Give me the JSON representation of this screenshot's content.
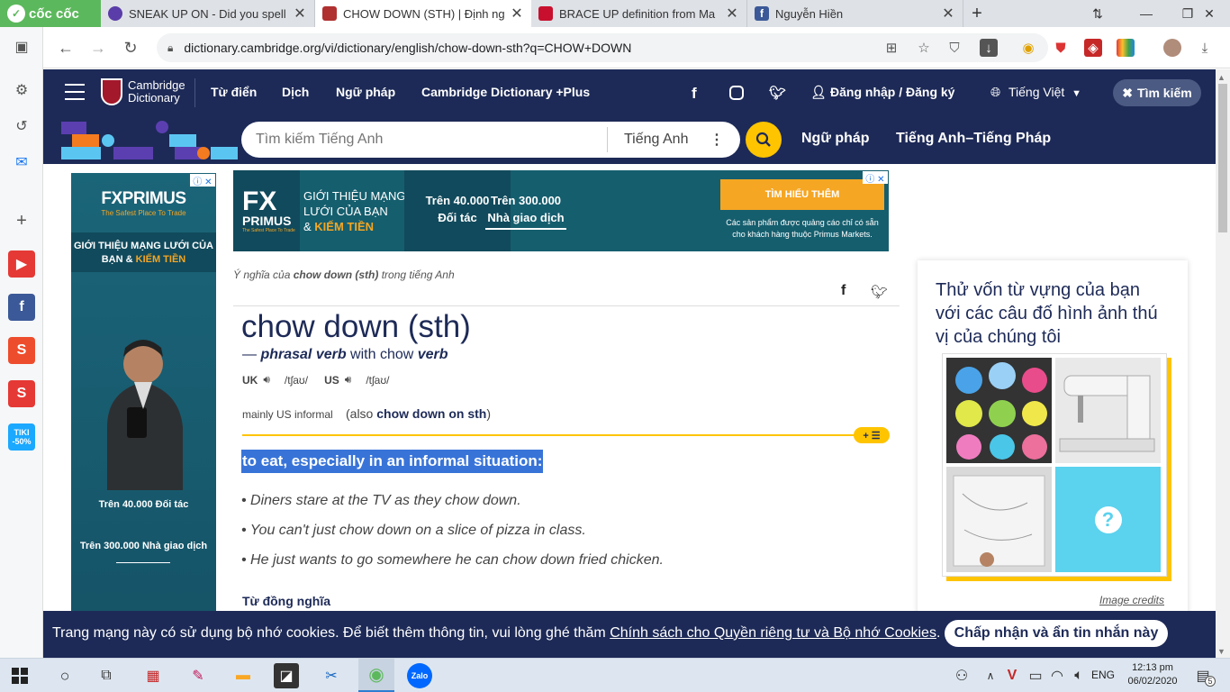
{
  "browser": {
    "brand": "cốc cốc",
    "tabs": [
      {
        "title": "SNEAK UP ON - Did you spell",
        "icon_color": "#5a3da8"
      },
      {
        "title": "CHOW DOWN (STH) | Định ng",
        "icon_color": "#b03030"
      },
      {
        "title": "BRACE UP definition from Ma",
        "icon_color": "#c8102e"
      },
      {
        "title": "Nguyễn Hiền",
        "icon_color": "#3b5998"
      }
    ],
    "new_tab": "+",
    "url": "dictionary.cambridge.org/vi/dictionary/english/chow-down-sth?q=CHOW+DOWN"
  },
  "site": {
    "logo_line1": "Cambridge",
    "logo_line2": "Dictionary",
    "nav": [
      "Từ điển",
      "Dịch",
      "Ngữ pháp",
      "Cambridge Dictionary +Plus"
    ],
    "login": "Đăng nhập / Đăng ký",
    "language": "Tiếng Việt",
    "search_close": "Tìm kiếm",
    "search_placeholder": "Tìm kiếm Tiếng Anh",
    "search_lang": "Tiếng Anh",
    "sub_nav": [
      "Ngữ pháp",
      "Tiếng Anh–Tiếng Pháp"
    ]
  },
  "ads": {
    "left": {
      "logo": "FXPRIMUS",
      "tagline": "The Safest Place To Trade",
      "headline_a": "GIỚI THIỆU MẠNG LƯỚI CỦA",
      "headline_b": "BẠN & ",
      "headline_c": "KIẾM TIỀN",
      "stat1": "Trên 40.000 Đối tác",
      "stat2": "Trên 300.000 Nhà giao dịch"
    },
    "top": {
      "logo_a": "FX",
      "logo_b": "PRIMUS",
      "logo_tag": "The Safest Place To Trade",
      "head_a": "GIỚI THIỆU MẠNG",
      "head_b": "LƯỚI CỦA BẠN",
      "head_c": "& ",
      "head_d": "KIẾM TIỀN",
      "stat1_a": "Trên 40.000",
      "stat1_b": "Đối tác",
      "stat2_a": "Trên 300.000",
      "stat2_b": "Nhà giao dịch",
      "cta": "TÌM HIỂU THÊM",
      "disclaimer_a": "Các sản phẩm được quảng cáo chỉ có sẵn",
      "disclaimer_b": "cho khách hàng thuộc Primus Markets."
    }
  },
  "entry": {
    "meaning_pre": "Ý nghĩa của ",
    "meaning_word": "chow down (sth)",
    "meaning_post": " trong tiếng Anh",
    "headword": "chow down (sth)",
    "pos_dash": "— ",
    "pos": "phrasal verb",
    "pos_with": " with chow ",
    "pos_verb": "verb",
    "uk": "UK",
    "uk_ipa": "/tʃaʊ/",
    "us": "US",
    "us_ipa": "/tʃaʊ/",
    "usage": "mainly US informal",
    "also_pre": "(also ",
    "also_word": "chow down on sth",
    "also_post": ")",
    "definition": "to eat, especially in an informal situation:",
    "examples": [
      "Diners stare at the TV as they chow down.",
      "You can't just chow down on a slice of pizza in class.",
      "He just wants to go somewhere he can chow down fried chicken."
    ],
    "synonyms_label": "Từ đồng nghĩa",
    "expand_btn": "+ ☰"
  },
  "sidebar": {
    "quiz_text": "Thử vốn từ vựng của bạn với các câu đố hình ảnh thú vị của chúng tôi",
    "image_credits": "Image credits",
    "question_mark": "?"
  },
  "cookie": {
    "text": "Trang mạng này có sử dụng bộ nhớ cookies. Để biết thêm thông tin, vui lòng ghé thăm ",
    "link": "Chính sách cho Quyền riêng tư và Bộ nhớ Cookies",
    "period": ".",
    "button": "Chấp nhận và ẩn tin nhắn này"
  },
  "taskbar": {
    "time": "12:13 pm",
    "date": "06/02/2020",
    "lang": "ENG",
    "notif_count": "5",
    "cococ_badge_a": "TIKI",
    "cococ_badge_b": "-50%"
  },
  "colors": {
    "cambridge_navy": "#1d2a57",
    "accent_yellow": "#fec400",
    "cococ_green": "#5cb85c"
  }
}
